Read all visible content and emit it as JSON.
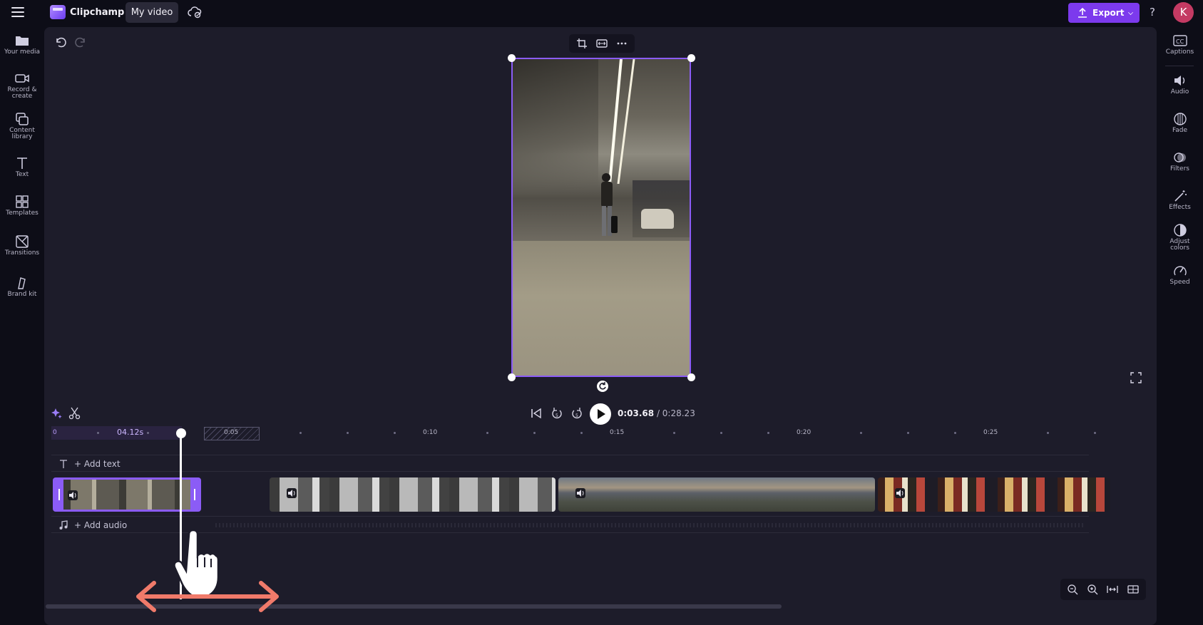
{
  "app": {
    "brand": "Clipchamp",
    "project_title": "My video",
    "avatar_initial": "K",
    "accent": "#7c3aed",
    "selection": "#8b5cf6"
  },
  "header": {
    "export_label": "Export",
    "help": "?"
  },
  "left_nav": [
    {
      "label": "Your media",
      "icon": "folder-icon"
    },
    {
      "label": "Record & create",
      "icon": "camera-icon"
    },
    {
      "label": "Content library",
      "icon": "library-icon"
    },
    {
      "label": "Text",
      "icon": "text-icon"
    },
    {
      "label": "Templates",
      "icon": "templates-icon"
    },
    {
      "label": "Transitions",
      "icon": "transitions-icon"
    },
    {
      "label": "Brand kit",
      "icon": "brand-kit-icon"
    }
  ],
  "right_nav": [
    {
      "label": "Captions",
      "icon": "captions-icon"
    },
    {
      "label": "Audio",
      "icon": "speaker-icon"
    },
    {
      "label": "Fade",
      "icon": "fade-icon"
    },
    {
      "label": "Filters",
      "icon": "filters-icon"
    },
    {
      "label": "Effects",
      "icon": "magic-wand-icon"
    },
    {
      "label": "Adjust colors",
      "icon": "contrast-icon"
    },
    {
      "label": "Speed",
      "icon": "speedometer-icon"
    }
  ],
  "playback": {
    "current": "0:03.68",
    "total": "/ 0:28.23"
  },
  "timeline": {
    "clip_duration": "04.12s",
    "ticks": [
      "0",
      "0:05",
      "0:10",
      "0:15",
      "0:20",
      "0:25"
    ],
    "add_text": "+ Add text",
    "add_audio": "+ Add audio"
  }
}
